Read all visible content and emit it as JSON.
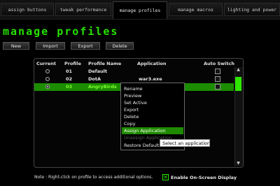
{
  "tabs": [
    {
      "label": "assign buttons"
    },
    {
      "label": "tweak performance"
    },
    {
      "label": "manage profiles",
      "active": true
    },
    {
      "label": "manage macros"
    },
    {
      "label": "lighting and power"
    }
  ],
  "page_title": "manage profiles",
  "toolbar": {
    "new": "New",
    "import": "Import",
    "export": "Export",
    "delete": "Delete"
  },
  "table": {
    "columns": [
      "Current",
      "Profile",
      "Profile Name",
      "Application",
      "Auto Switch"
    ],
    "rows": [
      {
        "profile": "01",
        "name": "Default",
        "application": "",
        "current": false,
        "auto_switch": false
      },
      {
        "profile": "02",
        "name": "DotA",
        "application": "war3.exe",
        "current": false,
        "auto_switch": false
      },
      {
        "profile": "03",
        "name": "AngryBirds",
        "application": "",
        "current": true,
        "auto_switch": false,
        "selected": true
      }
    ]
  },
  "context_menu": {
    "items": [
      {
        "label": "Rename"
      },
      {
        "label": "Preview"
      },
      {
        "label": "Set Active"
      },
      {
        "label": "Export"
      },
      {
        "label": "Delete"
      },
      {
        "label": "Copy"
      },
      {
        "label": "Assign Application",
        "highlighted": true
      },
      {
        "label": "Unassign Application",
        "disabled": true
      },
      {
        "label": "Restore Default"
      }
    ]
  },
  "tooltip": "Select an application",
  "footer": {
    "note": "Note : Right-click on profile to access additional options.",
    "osd_label": "Enable On-Screen Display",
    "osd_checked": true,
    "osd_check_glyph": "✕"
  },
  "scrollbar": {
    "up_glyph": "▲",
    "down_glyph": "▼"
  },
  "colors": {
    "accent": "#2ee800",
    "selection": "#1c8d00",
    "background": "#000000"
  }
}
